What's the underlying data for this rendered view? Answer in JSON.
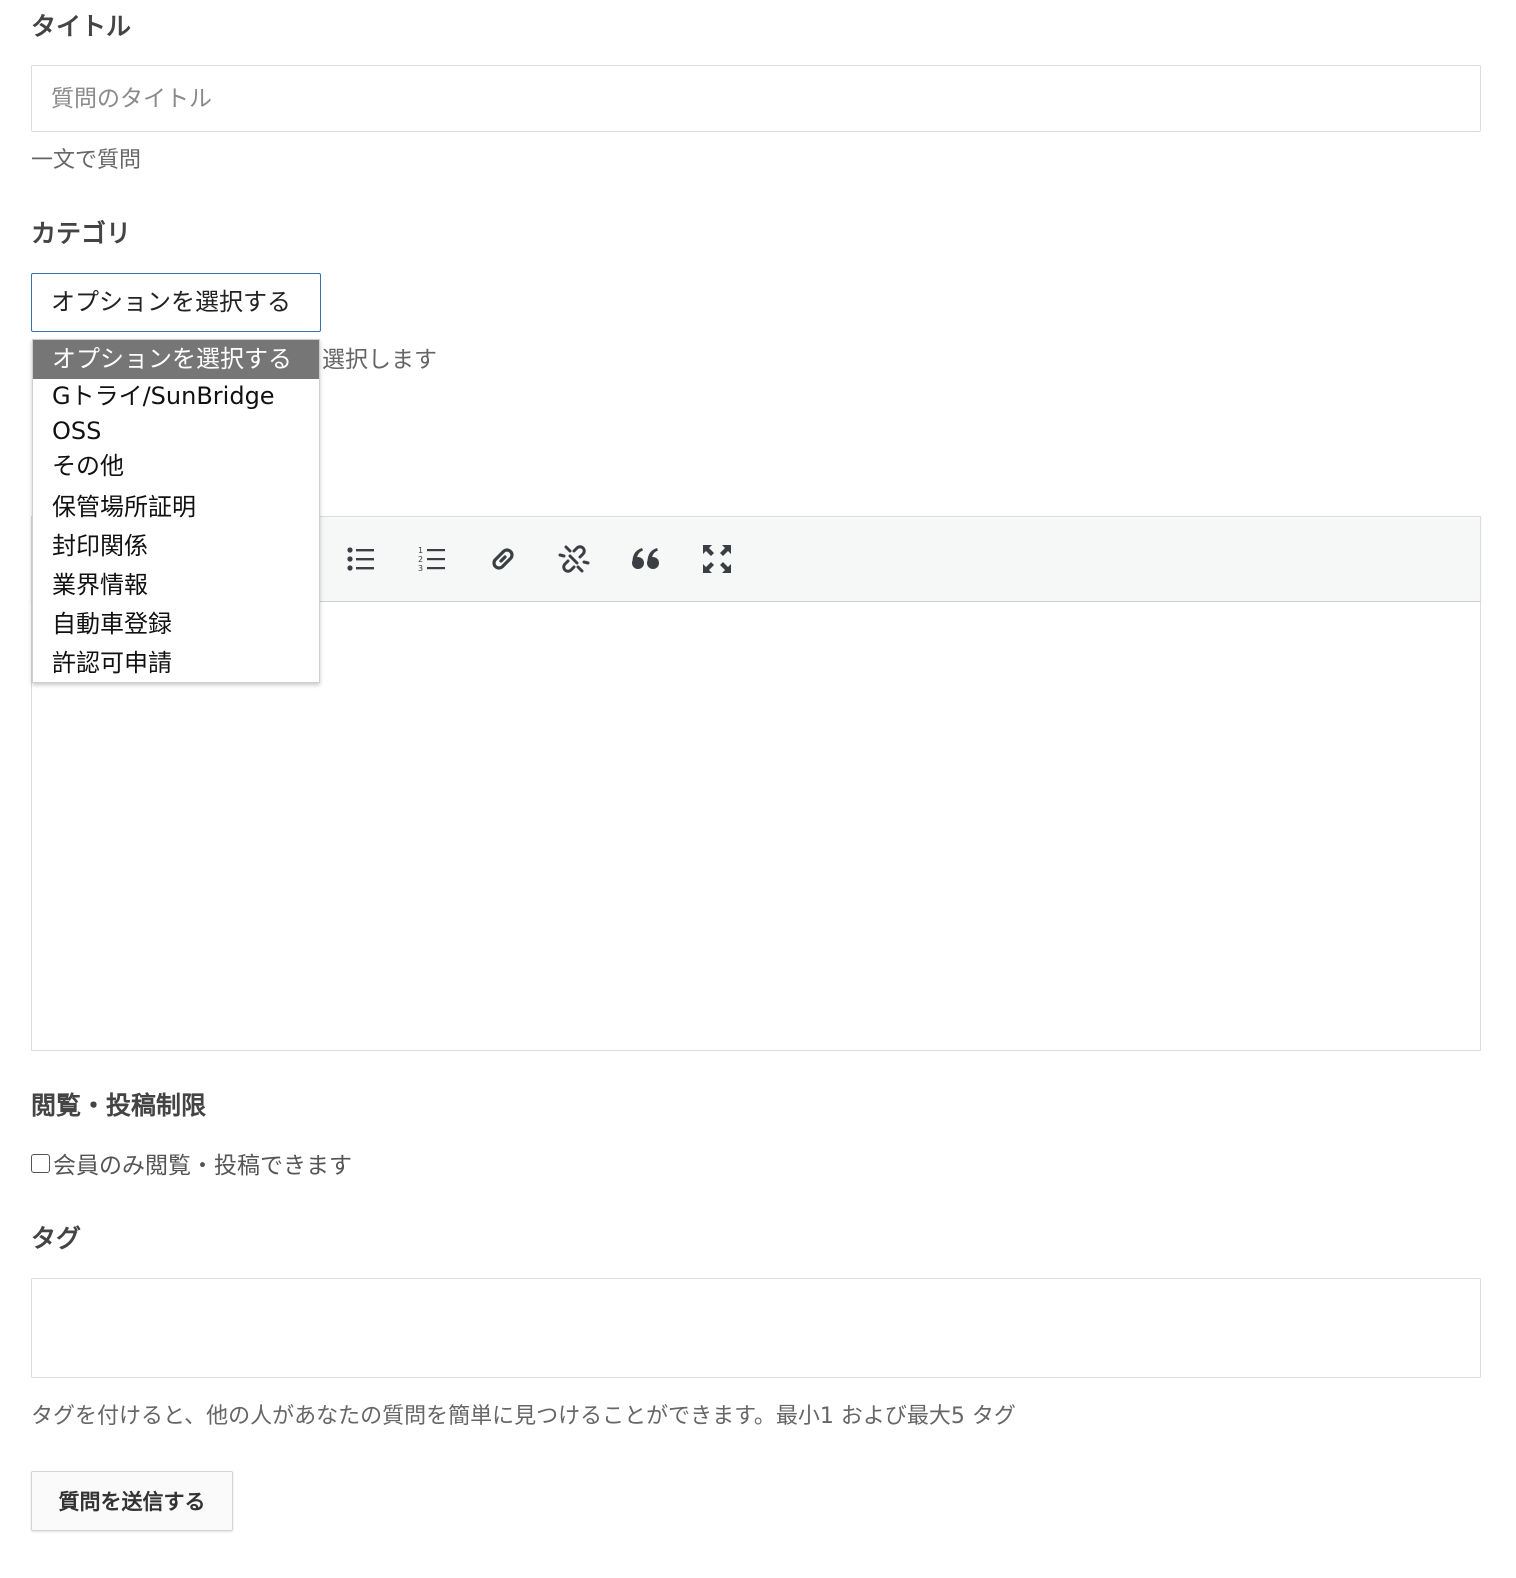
{
  "title_section": {
    "label": "タイトル",
    "placeholder": "質問のタイトル",
    "help": "一文で質問"
  },
  "category_section": {
    "label": "カテゴリ",
    "selected": "オプションを選択する",
    "help_visible_fragment": "選択します",
    "options": [
      "オプションを選択する",
      "Gトライ/SunBridge",
      "OSS",
      "その他",
      "保管場所証明",
      "封印関係",
      "業界情報",
      "自動車登録",
      "許認可申請"
    ]
  },
  "editor": {
    "toolbar_icons": [
      "bulleted-list-icon",
      "numbered-list-icon",
      "link-icon",
      "unlink-icon",
      "blockquote-icon",
      "fullscreen-icon"
    ]
  },
  "restriction_section": {
    "label": "閲覧・投稿制限",
    "checkbox_label": "会員のみ閲覧・投稿できます",
    "checked": false
  },
  "tags_section": {
    "label": "タグ",
    "help": "タグを付けると、他の人があなたの質問を簡単に見つけることができます。最小1 および最大5 タグ"
  },
  "submit": {
    "label": "質問を送信する"
  }
}
